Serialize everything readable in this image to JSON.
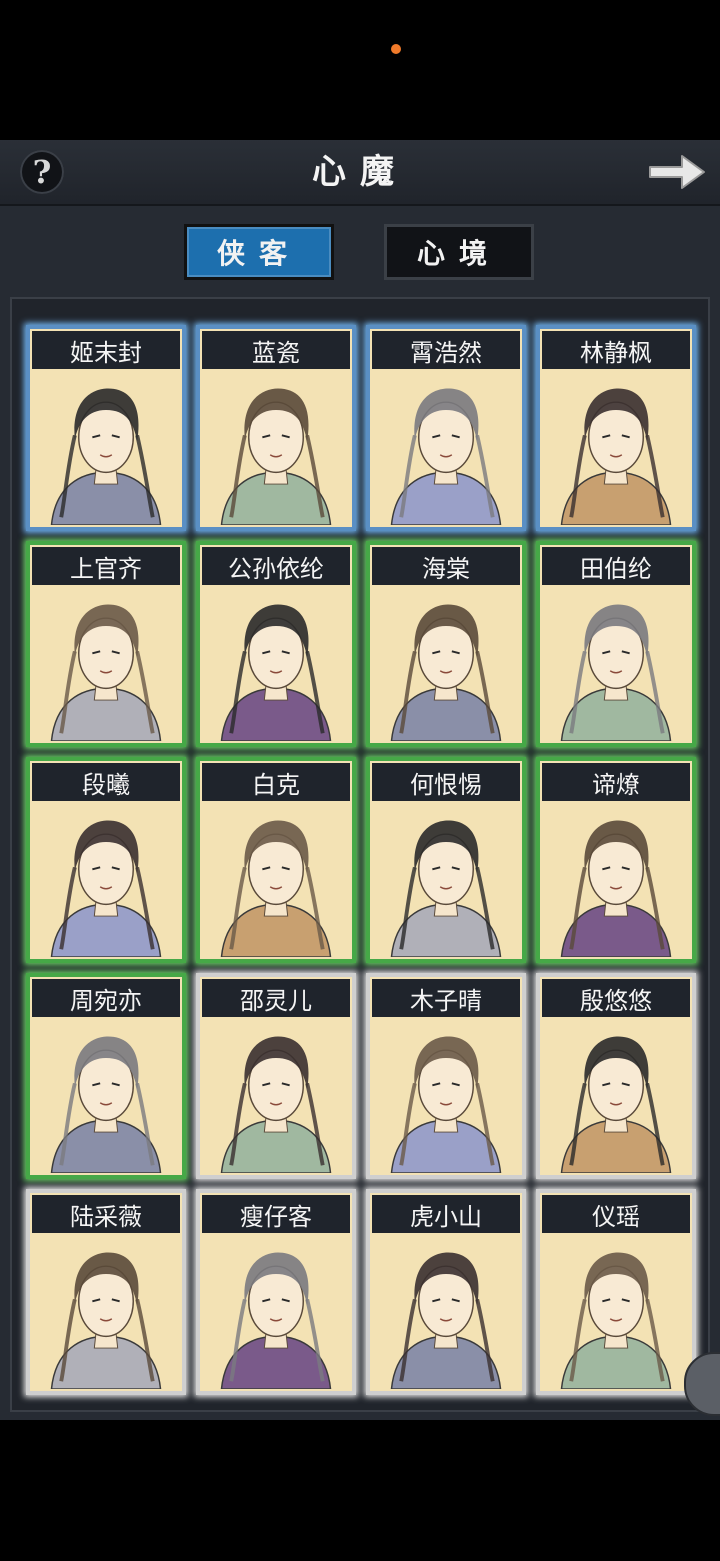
{
  "header": {
    "title": "心魔",
    "help_icon": "question-mark-icon",
    "next_icon": "arrow-right-icon"
  },
  "tabs": [
    {
      "label": "侠客",
      "active": true
    },
    {
      "label": "心境",
      "active": false
    }
  ],
  "colors": {
    "rarity_blue": "#6fb3ee",
    "rarity_green": "#6cd067",
    "rarity_white": "#e6e6e6",
    "card_bg": "#f3e2b4",
    "tab_active": "#1d6fae"
  },
  "characters": [
    {
      "name": "姬末封",
      "rarity": "blue"
    },
    {
      "name": "蓝瓷",
      "rarity": "blue"
    },
    {
      "name": "霄浩然",
      "rarity": "blue"
    },
    {
      "name": "林静枫",
      "rarity": "blue"
    },
    {
      "name": "上官齐",
      "rarity": "green"
    },
    {
      "name": "公孙依纶",
      "rarity": "green"
    },
    {
      "name": "海棠",
      "rarity": "green"
    },
    {
      "name": "田伯纶",
      "rarity": "green"
    },
    {
      "name": "段曦",
      "rarity": "green"
    },
    {
      "name": "白克",
      "rarity": "green"
    },
    {
      "name": "何恨惕",
      "rarity": "green"
    },
    {
      "name": "谛燎",
      "rarity": "green"
    },
    {
      "name": "周宛亦",
      "rarity": "green"
    },
    {
      "name": "邵灵儿",
      "rarity": "white"
    },
    {
      "name": "木子晴",
      "rarity": "white"
    },
    {
      "name": "殷悠悠",
      "rarity": "white"
    },
    {
      "name": "陆采薇",
      "rarity": "white"
    },
    {
      "name": "瘦仔客",
      "rarity": "white"
    },
    {
      "name": "虎小山",
      "rarity": "white"
    },
    {
      "name": "仪瑶",
      "rarity": "white"
    }
  ]
}
